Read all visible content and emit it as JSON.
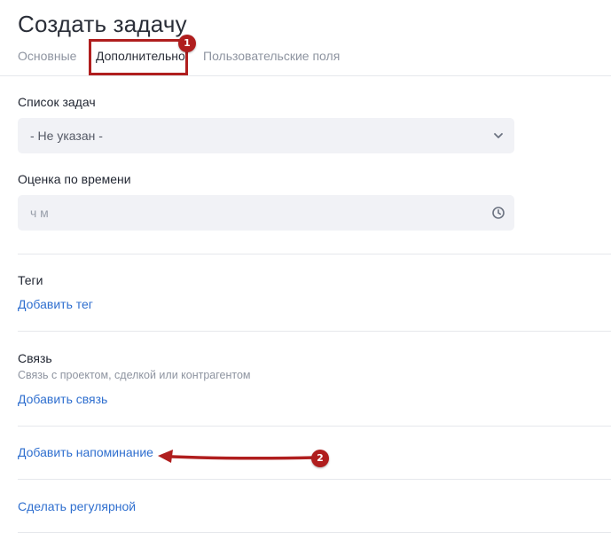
{
  "page": {
    "title": "Создать задачу"
  },
  "tabs": [
    {
      "label": "Основные",
      "active": false
    },
    {
      "label": "Дополнительно",
      "active": true
    },
    {
      "label": "Пользовательские поля",
      "active": false
    }
  ],
  "task_list": {
    "label": "Список задач",
    "value": "- Не указан -",
    "icon": "chevron-down-icon"
  },
  "time_estimate": {
    "label": "Оценка по времени",
    "placeholder": "ч м",
    "icon": "clock-icon"
  },
  "tags": {
    "label": "Теги",
    "add_link": "Добавить тег"
  },
  "relation": {
    "label": "Связь",
    "hint": "Связь с проектом, сделкой или контрагентом",
    "add_link": "Добавить связь"
  },
  "reminder": {
    "add_link": "Добавить напоминание"
  },
  "recurring": {
    "link": "Сделать регулярной"
  },
  "annotations": {
    "marker_1": "1",
    "marker_2": "2",
    "color": "#b01e1e"
  },
  "colors": {
    "link": "#2f6fcf",
    "muted": "#8e94a0",
    "field_bg": "#f1f2f6"
  }
}
